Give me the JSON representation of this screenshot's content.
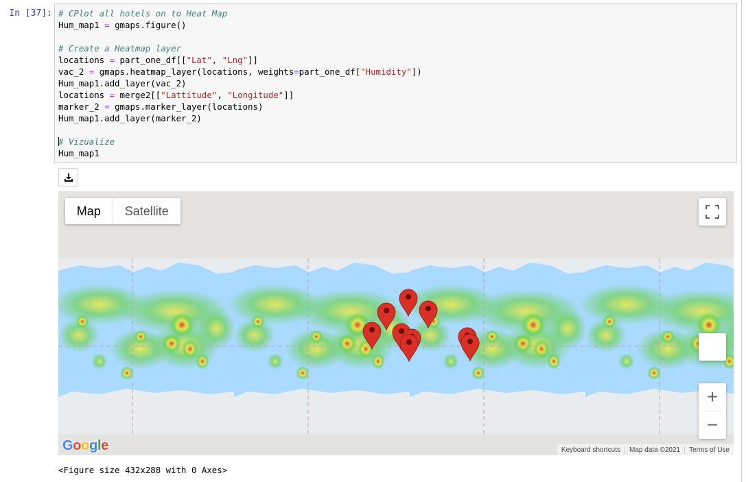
{
  "cell": {
    "prompt": "In [37]:",
    "code": {
      "c1": "# CPlot all hotels on to Heat Map",
      "l2a": "Hum_map1 ",
      "l2op": "=",
      "l2b": " gmaps.figure()",
      "c2": "# Create a Heatmap layer",
      "l5a": "locations ",
      "l5op": "=",
      "l5b": " part_one_df[[",
      "l5s1": "\"Lat\"",
      "l5c": ", ",
      "l5s2": "\"Lng\"",
      "l5d": "]]",
      "l6a": "vac_2 ",
      "l6op": "=",
      "l6b": " gmaps.heatmap_layer(locations, weights",
      "l6op2": "=",
      "l6c": "part_one_df[",
      "l6s": "\"Humidity\"",
      "l6d": "])",
      "l7": "Hum_map1.add_layer(vac_2)",
      "l8a": "locations ",
      "l8op": "=",
      "l8b": " merge2[[",
      "l8s1": "\"Lattitude\"",
      "l8c": ", ",
      "l8s2": "\"Longitude\"",
      "l8d": "]]",
      "l9a": "marker_2 ",
      "l9op": "=",
      "l9b": " gmaps.marker_layer(locations)",
      "l10": "Hum_map1.add_layer(marker_2)",
      "c3": "# Vizualize",
      "l13": "Hum_map1"
    }
  },
  "map": {
    "type_map": "Map",
    "type_satellite": "Satellite",
    "zoom_in": "+",
    "zoom_out": "−",
    "logo": {
      "G": "G",
      "o1": "o",
      "o2": "o",
      "g": "g",
      "l": "l",
      "e": "e"
    },
    "attribution": [
      "Keyboard shortcuts",
      "Map data ©2021",
      "Terms of Use"
    ],
    "colors": {
      "ocean": "#aadaff",
      "land": "#e5e3df",
      "marker": "#d93025",
      "heat_low": "#6fd15a",
      "heat_mid": "#f2ea3c",
      "heat_high": "#e03a3a"
    }
  },
  "output": "<Figure size 432x288 with 0 Axes>",
  "icons": [
    "download-icon",
    "fullscreen-icon",
    "map-marker-icon"
  ]
}
